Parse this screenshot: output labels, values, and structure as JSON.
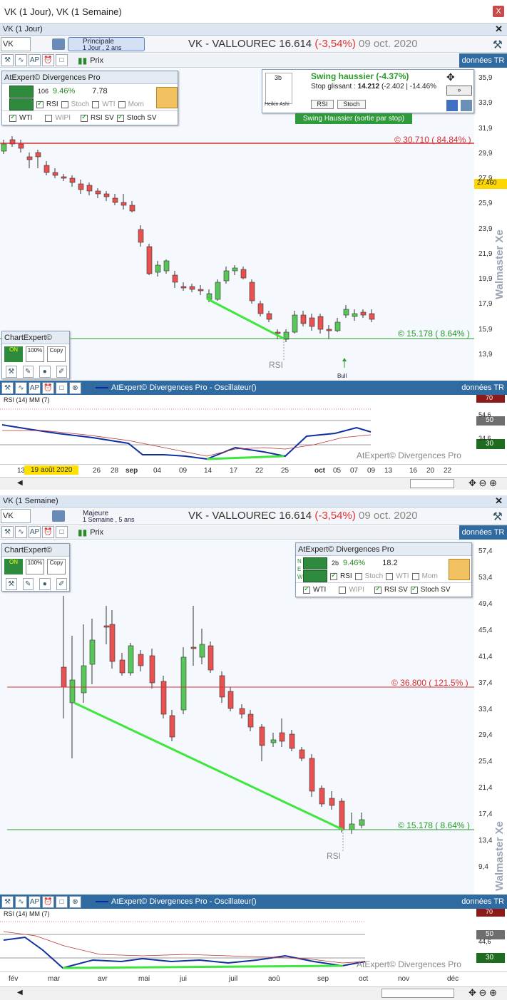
{
  "window": {
    "title": "VK (1 Jour), VK (1 Semaine)",
    "close_symbol": "X"
  },
  "top": {
    "subtitle": "VK (1 Jour)",
    "symbol": "VK",
    "period_title": "Principale",
    "period_sub": "1 Jour , 2 ans",
    "title_name": "VK - VALLOUREC",
    "price": "16.614",
    "change": "(-3,54%)",
    "date": "09 oct. 2020",
    "donnees": "données TR",
    "prix": "Prix",
    "price_axis": [
      "35,9",
      "33,9",
      "31,9",
      "29,9",
      "27,9",
      "25,9",
      "23,9",
      "21,9",
      "19,9",
      "17,9",
      "15,9",
      "13,9"
    ],
    "current_price_tag": "27.460",
    "resistance_label": "© 30.710 ( 84.84% )",
    "support_label": "© 15.178 ( 8.64% )",
    "rsi_marker": "RSI",
    "bull_marker": "Bull",
    "watermark": "Walmaster Xe",
    "divpanel": {
      "title": "AtExpert© Divergences Pro",
      "pct": "9.46%",
      "n": "106",
      "val": "7.78",
      "rsi": "RSI",
      "stoch": "Stoch",
      "wti": "WTI",
      "mom": "Mom",
      "wti2": "WTI",
      "wipi": "WIPI",
      "rsisv": "RSI SV",
      "stochsv": "Stoch SV"
    },
    "swing": {
      "title": "Swing haussier (-4.37%)",
      "stop_label": "Stop glissant :",
      "stop_val": "14.212",
      "stop_delta": "(-2.402 | -14.46%",
      "rsi": "RSI",
      "stoch": "Stoch",
      "heikin": "Heikin Ashi",
      "h3b": "3b",
      "banner": "Swing Haussier (sortie par stop)"
    },
    "chartexpert": {
      "title": "ChartExpert©",
      "on": "ON",
      "p100": "100%",
      "copy": "Copy"
    },
    "osc": {
      "title": "AtExpert© Divergences Pro - Oscillateur()",
      "donnees": "données TR",
      "rsi_label": "RSI (14) MM (7)",
      "levels": [
        "70",
        "50",
        "30"
      ],
      "axis_mid": [
        "54,6",
        "34,6"
      ],
      "watermark": "AtExpert© Divergences Pro"
    },
    "dates": [
      "13",
      "19 août 2020",
      "26",
      "28",
      "sep",
      "04",
      "09",
      "14",
      "17",
      "22",
      "25",
      "oct",
      "05",
      "07",
      "09",
      "13",
      "16",
      "20",
      "22"
    ]
  },
  "bottom": {
    "subtitle": "VK (1 Semaine)",
    "symbol": "VK",
    "period_title": "Majeure",
    "period_sub": "1 Semaine , 5 ans",
    "title_name": "VK - VALLOUREC",
    "price": "16.614",
    "change": "(-3,54%)",
    "date": "09 oct. 2020",
    "donnees": "données TR",
    "prix": "Prix",
    "price_axis": [
      "57,4",
      "53,4",
      "49,4",
      "45,4",
      "41,4",
      "37,4",
      "33,4",
      "29,4",
      "25,4",
      "21,4",
      "17,4",
      "13,4",
      "9,4"
    ],
    "resistance_label": "© 36.800 ( 121.5% )",
    "support_label": "© 15.178 ( 8.64% )",
    "rsi_marker": "RSI",
    "watermark": "Walmaster Xe",
    "divpanel": {
      "title": "AtExpert© Divergences Pro",
      "pct": "9.46%",
      "n": "2b",
      "val": "18.2",
      "rsi": "RSI",
      "stoch": "Stoch",
      "wti": "WTI",
      "mom": "Mom",
      "wti2": "WTI",
      "wipi": "WIPI",
      "rsisv": "RSI SV",
      "stochsv": "Stoch SV",
      "n_letter": "N",
      "e_letter": "E",
      "w_letter": "W"
    },
    "chartexpert": {
      "title": "ChartExpert©",
      "on": "ON",
      "p100": "100%",
      "copy": "Copy"
    },
    "osc": {
      "title": "AtExpert© Divergences Pro - Oscillateur()",
      "donnees": "données TR",
      "rsi_label": "RSI (14) MM (7)",
      "levels": [
        "70",
        "50",
        "30"
      ],
      "axis_mid": [
        "44,6"
      ],
      "watermark": "AtExpert© Divergences Pro"
    },
    "dates": [
      "fév",
      "mar",
      "avr",
      "mai",
      "jui",
      "juil",
      "aoû",
      "sep",
      "oct",
      "nov",
      "déc"
    ]
  },
  "colors": {
    "up": "#59c65a",
    "down": "#e95050",
    "resistance": "#d83030",
    "support": "#2a9a2a",
    "divergence": "#3ee63e",
    "header_blue": "#2f6aa0"
  }
}
